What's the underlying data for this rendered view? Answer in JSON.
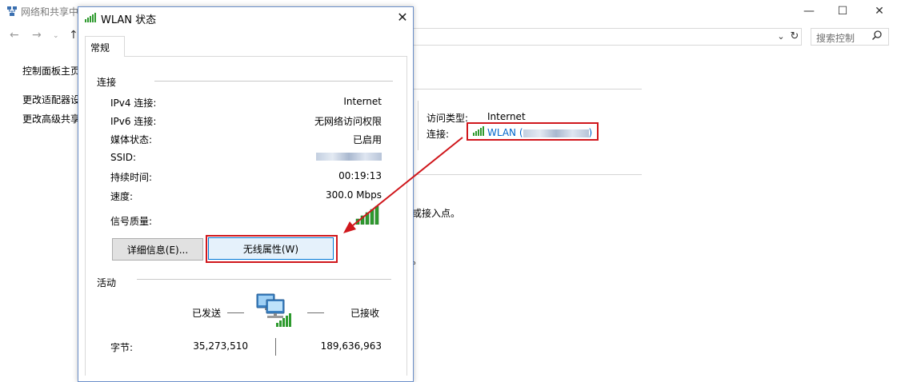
{
  "background_window": {
    "title": "网络和共享中",
    "search_placeholder": "搜索控制",
    "sidebar": [
      "控制面板主页",
      "更改适配器设",
      "更改高级共享"
    ],
    "access_type_label": "访问类型:",
    "access_type_value": "Internet",
    "connection_label": "连接:",
    "wlan_link": "WLAN (",
    "wlan_link_end": ")",
    "partial_text_1": "或接入点。",
    "partial_text_2": "。"
  },
  "dialog": {
    "title": "WLAN 状态",
    "tab": "常规",
    "connection_section": "连接",
    "rows": [
      {
        "label": "IPv4 连接:",
        "value": "Internet"
      },
      {
        "label": "IPv6 连接:",
        "value": "无网络访问权限"
      },
      {
        "label": "媒体状态:",
        "value": "已启用"
      },
      {
        "label": "SSID:",
        "value": ""
      },
      {
        "label": "持续时间:",
        "value": "00:19:13"
      },
      {
        "label": "速度:",
        "value": "300.0 Mbps"
      },
      {
        "label": "信号质量:",
        "value": ""
      }
    ],
    "details_button": "详细信息(E)...",
    "wireless_button": "无线属性(W)",
    "activity_section": "活动",
    "sent_label": "已发送",
    "received_label": "已接收",
    "bytes_label": "字节:",
    "bytes_sent": "35,273,510",
    "bytes_received": "189,636,963"
  },
  "colors": {
    "annotation_red": "#d0171c",
    "link_blue": "#0066cc",
    "signal_green": "#2e9a2e"
  }
}
